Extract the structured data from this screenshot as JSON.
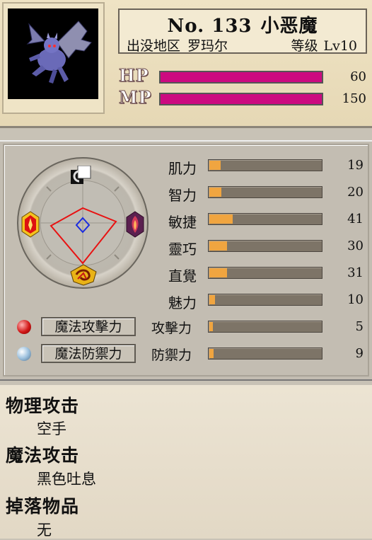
{
  "monster": {
    "number": "No. 133",
    "name": "小恶魔",
    "area_label": "出没地区",
    "area": "罗玛尔",
    "level_label": "等级",
    "level": "Lv10",
    "hp_label": "HP",
    "hp": "60",
    "mp_label": "MP",
    "mp": "150"
  },
  "stats": [
    {
      "name": "肌力",
      "value": "19",
      "fill": 0.1
    },
    {
      "name": "智力",
      "value": "20",
      "fill": 0.11
    },
    {
      "name": "敏捷",
      "value": "41",
      "fill": 0.21
    },
    {
      "name": "靈巧",
      "value": "30",
      "fill": 0.16
    },
    {
      "name": "直覺",
      "value": "31",
      "fill": 0.16
    },
    {
      "name": "魅力",
      "value": "10",
      "fill": 0.05
    },
    {
      "name": "攻擊力",
      "value": "5",
      "fill": 0.03
    },
    {
      "name": "防禦力",
      "value": "9",
      "fill": 0.04
    }
  ],
  "magic": {
    "attack_button": "魔法攻擊力",
    "defense_button": "魔法防禦力"
  },
  "details": {
    "physical_title": "物理攻击",
    "physical_value": "空手",
    "magic_title": "魔法攻击",
    "magic_value": "黑色吐息",
    "drop_title": "掉落物品",
    "drop_value": "无"
  },
  "colors": {
    "hp_mp_bar": "#cc0a80",
    "stat_fill": "#f0a540",
    "stat_track": "#7d7467"
  },
  "icons": {
    "portrait": "gargoyle-portrait",
    "top_element": "white-square-moon-icon",
    "left_element": "red-fire-crest-icon",
    "right_element": "purple-flame-crest-icon",
    "bottom_element": "gold-swirl-crest-icon"
  }
}
